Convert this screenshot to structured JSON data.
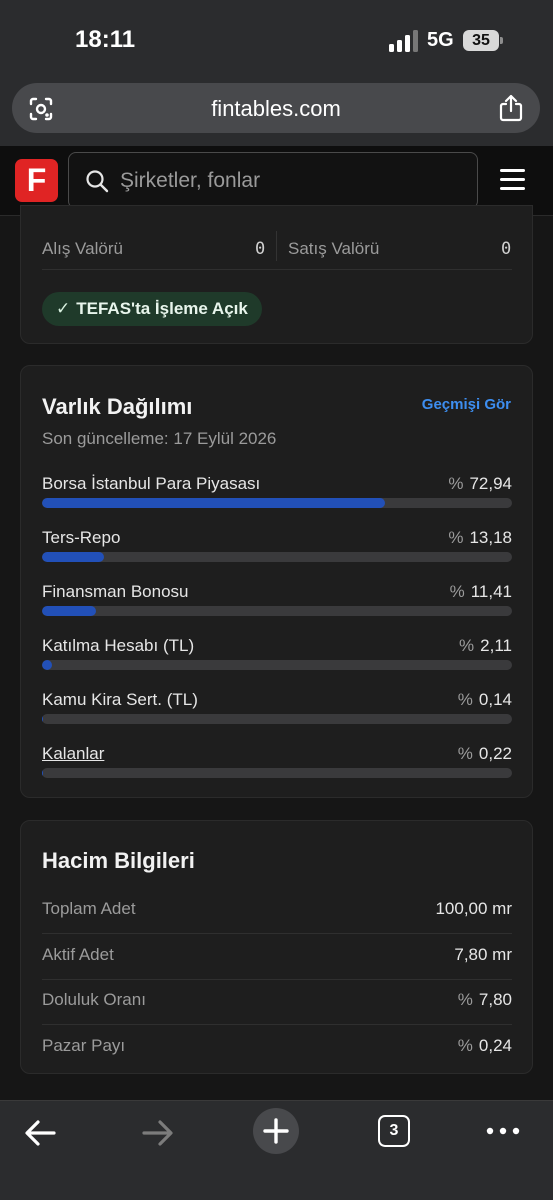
{
  "status_bar": {
    "time": "18:11",
    "network": "5G",
    "battery": "35"
  },
  "browser": {
    "url": "fintables.com",
    "tab_count": "3"
  },
  "site_header": {
    "logo_letter": "F",
    "search_placeholder": "Şirketler, fonlar"
  },
  "valor": {
    "buy_label": "Alış Valörü",
    "buy_value": "0",
    "sell_label": "Satış Valörü",
    "sell_value": "0",
    "tefas_badge_check": "✓",
    "tefas_badge": "TEFAS'ta İşleme Açık"
  },
  "allocation": {
    "title": "Varlık Dağılımı",
    "history_link": "Geçmişi Gör",
    "updated": "Son güncelleme: 17 Eylül 2026",
    "percent_sign": "%",
    "items": [
      {
        "name": "Borsa İstanbul Para Piyasası",
        "value": "72,94",
        "fraction": 0.7294
      },
      {
        "name": "Ters-Repo",
        "value": "13,18",
        "fraction": 0.1318
      },
      {
        "name": "Finansman Bonosu",
        "value": "11,41",
        "fraction": 0.1141
      },
      {
        "name": "Katılma Hesabı (TL)",
        "value": "2,11",
        "fraction": 0.0211
      },
      {
        "name": "Kamu Kira Sert. (TL)",
        "value": "0,14",
        "fraction": 0.0014
      },
      {
        "name": "Kalanlar",
        "value": "0,22",
        "fraction": 0.0022
      }
    ],
    "bar_color": "#2250b8"
  },
  "volume": {
    "title": "Hacim Bilgileri",
    "rows": [
      {
        "label": "Toplam Adet",
        "value": "100,00 mr"
      },
      {
        "label": "Aktif Adet",
        "value": "7,80 mr"
      },
      {
        "label": "Doluluk Oranı",
        "value": "7,80",
        "percent": true
      },
      {
        "label": "Pazar Payı",
        "value": "0,24",
        "percent": true
      }
    ]
  },
  "colors": {
    "brand": "#e02424",
    "link": "#3d8ef0",
    "badge_bg": "#1f3a2a"
  }
}
